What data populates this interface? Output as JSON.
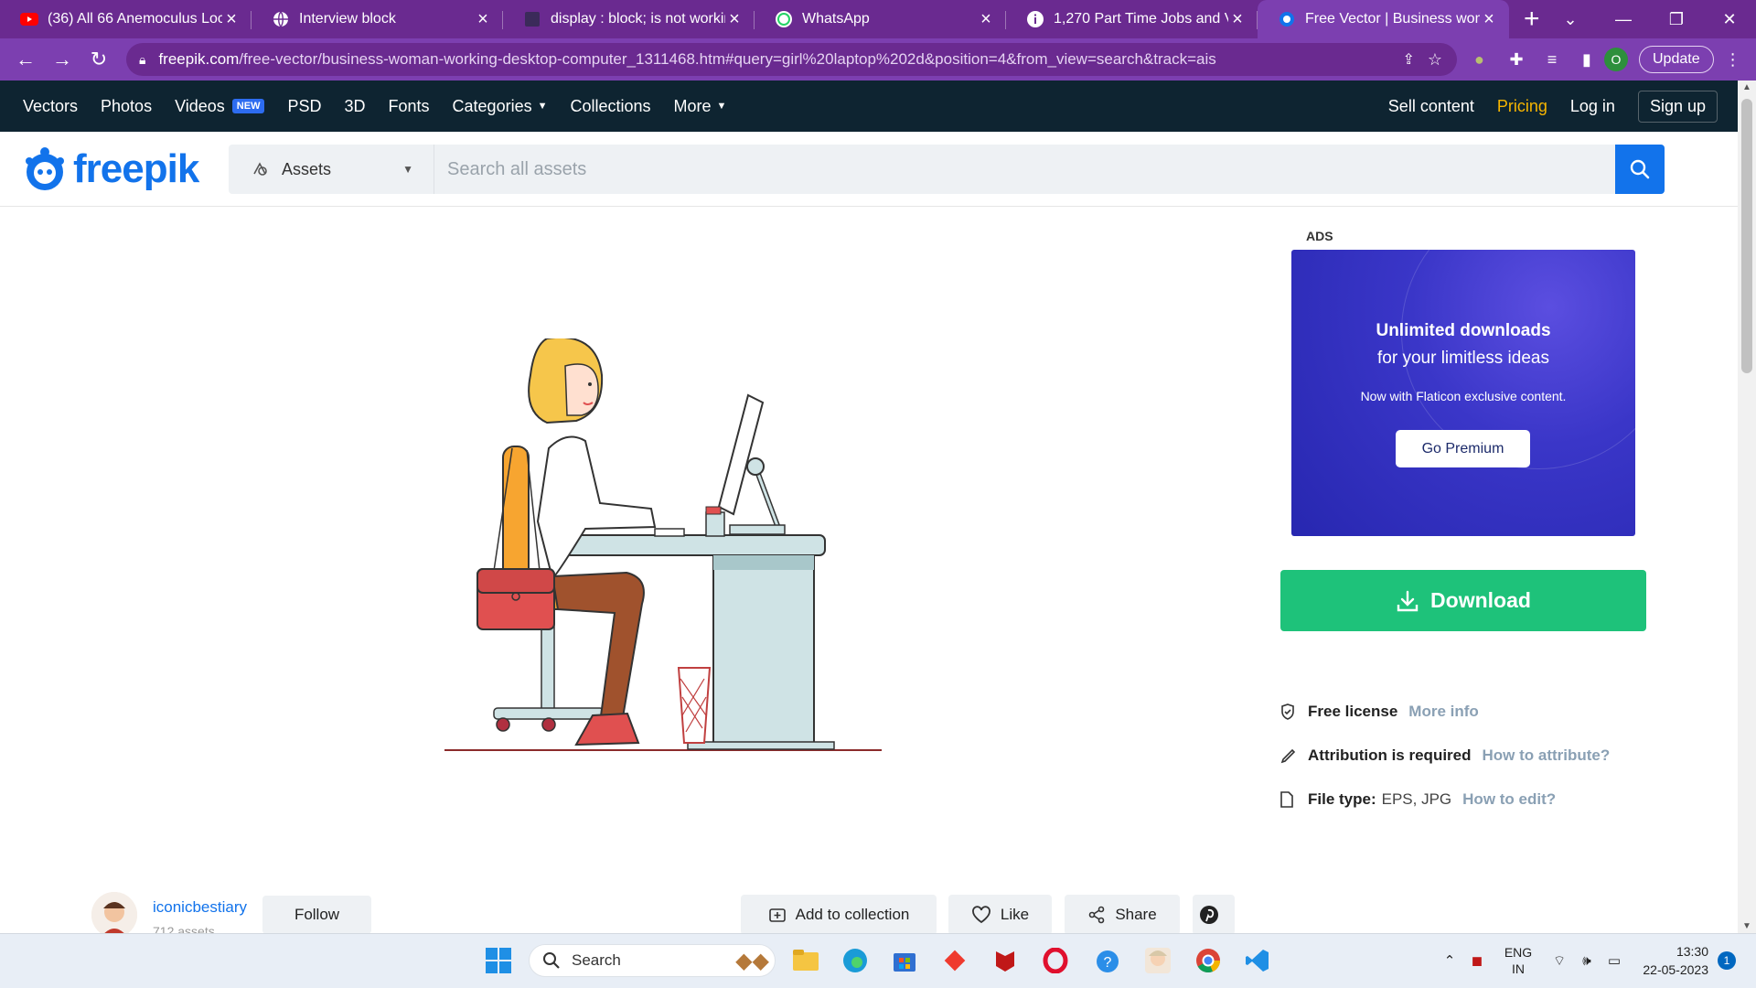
{
  "browser": {
    "tabs": [
      {
        "title": "(36) All 66 Anemoculus Loc",
        "icon": "youtube-icon"
      },
      {
        "title": "Interview block",
        "icon": "globe-icon"
      },
      {
        "title": "display : block; is not workin",
        "icon": "page-icon"
      },
      {
        "title": "WhatsApp",
        "icon": "whatsapp-icon"
      },
      {
        "title": "1,270 Part Time Jobs and V",
        "icon": "info-icon"
      },
      {
        "title": "Free Vector | Business wom",
        "icon": "freepik-icon",
        "active": true
      }
    ],
    "url_host": "freepik.com",
    "url_path": "/free-vector/business-woman-working-desktop-computer_1311468.htm#query=girl%20laptop%202d&position=4&from_view=search&track=ais",
    "profile_initial": "O",
    "update_label": "Update"
  },
  "nav": {
    "items": [
      "Vectors",
      "Photos",
      "Videos",
      "PSD",
      "3D",
      "Fonts",
      "Categories",
      "Collections",
      "More"
    ],
    "new_badge": "NEW",
    "sell": "Sell content",
    "pricing": "Pricing",
    "login": "Log in",
    "signup": "Sign up"
  },
  "header": {
    "logo": "freepik",
    "assets_label": "Assets",
    "search_placeholder": "Search all assets"
  },
  "ad": {
    "label": "ADS",
    "line1": "Unlimited downloads",
    "line2": "for your limitless ideas",
    "line3": "Now with Flaticon exclusive content.",
    "button": "Go Premium"
  },
  "download": {
    "label": "Download"
  },
  "license": {
    "free": "Free license",
    "free_link": "More info",
    "attr": "Attribution is required",
    "attr_link": "How to attribute?",
    "filetype_key": "File type:",
    "filetype_val": "EPS, JPG",
    "filetype_link": "How to edit?"
  },
  "author": {
    "name": "iconicbestiary",
    "count": "712 assets",
    "follow": "Follow"
  },
  "actions": {
    "collection": "Add to collection",
    "like": "Like",
    "share": "Share"
  },
  "taskbar": {
    "search": "Search",
    "lang1": "ENG",
    "lang2": "IN",
    "time": "13:30",
    "date": "22-05-2023",
    "notifications": "1"
  },
  "colors": {
    "tab_bar": "#6a2a90",
    "nav_bg": "#0e2431",
    "brand_blue": "#1273eb",
    "download_green": "#1ec27a",
    "pricing": "#f7b500"
  }
}
